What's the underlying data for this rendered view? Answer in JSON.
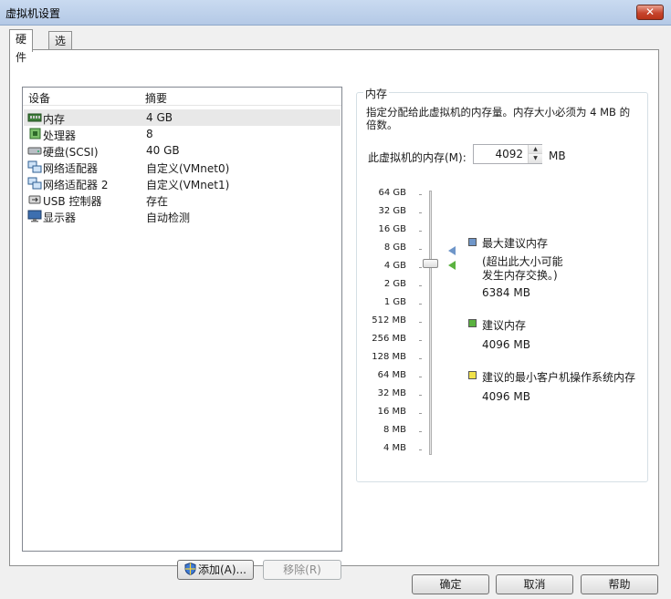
{
  "window": {
    "title": "虚拟机设置",
    "close_glyph": "✕"
  },
  "tabs": [
    {
      "label": "硬件",
      "active": true
    },
    {
      "label": "选项",
      "active": false
    }
  ],
  "device_table": {
    "col_device": "设备",
    "col_summary": "摘要",
    "rows": [
      {
        "name": "内存",
        "summary": "4 GB",
        "icon": "memory-icon",
        "selected": true
      },
      {
        "name": "处理器",
        "summary": "8",
        "icon": "processor-icon",
        "selected": false
      },
      {
        "name": "硬盘(SCSI)",
        "summary": "40 GB",
        "icon": "hard-disk-icon",
        "selected": false
      },
      {
        "name": "网络适配器",
        "summary": "自定义(VMnet0)",
        "icon": "network-adapter-icon",
        "selected": false
      },
      {
        "name": "网络适配器 2",
        "summary": "自定义(VMnet1)",
        "icon": "network-adapter-icon",
        "selected": false
      },
      {
        "name": "USB 控制器",
        "summary": "存在",
        "icon": "usb-icon",
        "selected": false
      },
      {
        "name": "显示器",
        "summary": "自动检测",
        "icon": "display-icon",
        "selected": false
      }
    ]
  },
  "actions": {
    "add_label": "添加(A)...",
    "remove_label": "移除(R)"
  },
  "memory": {
    "group_title": "内存",
    "description": "指定分配给此虚拟机的内存量。内存大小必须为 4 MB 的倍数。",
    "field_label": "此虚拟机的内存(M):",
    "value": "4092",
    "unit": "MB",
    "scale": [
      "64 GB",
      "32 GB",
      "16 GB",
      "8 GB",
      "4 GB",
      "2 GB",
      "1 GB",
      "512 MB",
      "256 MB",
      "128 MB",
      "64 MB",
      "32 MB",
      "16 MB",
      "8 MB",
      "4 MB"
    ],
    "max_recommended": {
      "title": "最大建议内存",
      "note_line1": "(超出此大小可能",
      "note_line2": "发生内存交换。)",
      "value": "6384 MB",
      "color": "#6f96c9"
    },
    "recommended": {
      "title": "建议内存",
      "value": "4096 MB",
      "color": "#5ab23f"
    },
    "min_guest": {
      "title": "建议的最小客户机操作系统内存",
      "value": "4096 MB",
      "color": "#f1e24a"
    }
  },
  "footer": {
    "ok_label": "确定",
    "cancel_label": "取消",
    "help_label": "帮助"
  }
}
